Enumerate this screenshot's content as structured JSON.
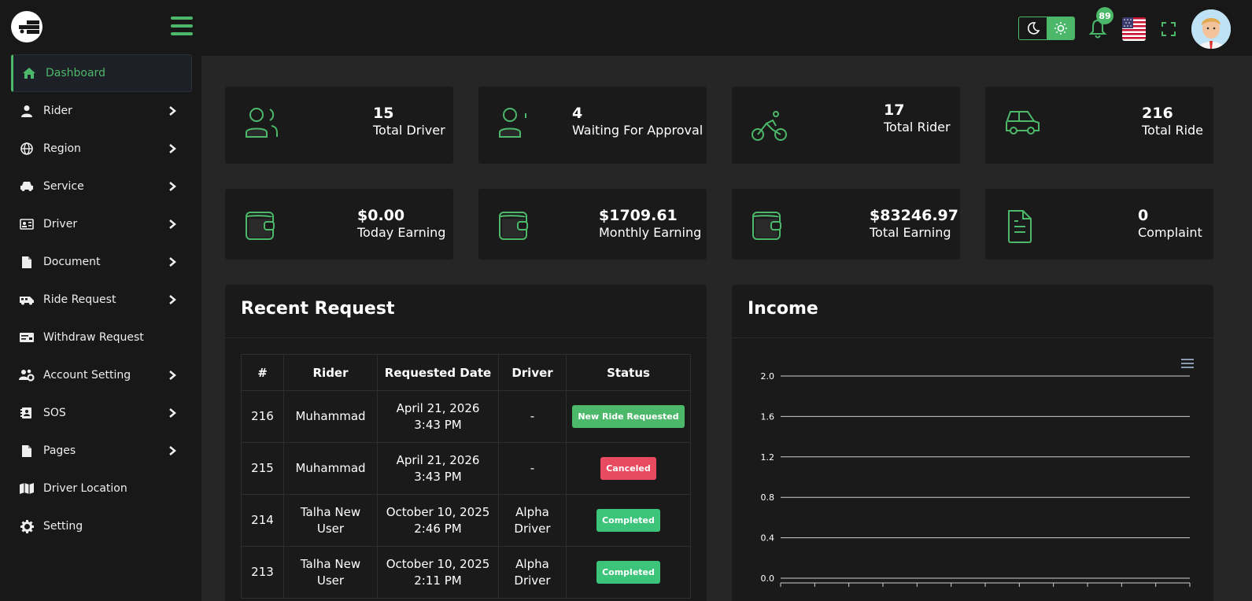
{
  "sidebar": {
    "items": [
      {
        "label": "Dashboard",
        "icon": "home-icon",
        "active": true,
        "has_submenu": false
      },
      {
        "label": "Rider",
        "icon": "user-icon",
        "active": false,
        "has_submenu": true
      },
      {
        "label": "Region",
        "icon": "globe-icon",
        "active": false,
        "has_submenu": true
      },
      {
        "label": "Service",
        "icon": "car-icon",
        "active": false,
        "has_submenu": true
      },
      {
        "label": "Driver",
        "icon": "id-card-icon",
        "active": false,
        "has_submenu": true
      },
      {
        "label": "Document",
        "icon": "file-icon",
        "active": false,
        "has_submenu": true
      },
      {
        "label": "Ride Request",
        "icon": "shuttle-icon",
        "active": false,
        "has_submenu": true
      },
      {
        "label": "Withdraw Request",
        "icon": "money-check-icon",
        "active": false,
        "has_submenu": false
      },
      {
        "label": "Account Setting",
        "icon": "users-cog-icon",
        "active": false,
        "has_submenu": true
      },
      {
        "label": "SOS",
        "icon": "address-book-icon",
        "active": false,
        "has_submenu": true
      },
      {
        "label": "Pages",
        "icon": "file-icon",
        "active": false,
        "has_submenu": true
      },
      {
        "label": "Driver Location",
        "icon": "map-icon",
        "active": false,
        "has_submenu": false
      },
      {
        "label": "Setting",
        "icon": "gear-icon",
        "active": false,
        "has_submenu": false
      }
    ]
  },
  "topbar": {
    "notification_count": "89",
    "language": "en-US",
    "theme": "dark"
  },
  "stats": [
    {
      "value": "15",
      "label": "Total Driver",
      "icon": "users-icon"
    },
    {
      "value": "4",
      "label": "Waiting For Approval",
      "icon": "user-pending-icon"
    },
    {
      "value": "17",
      "label": "Total Rider",
      "icon": "bicycle-icon"
    },
    {
      "value": "216",
      "label": "Total Ride",
      "icon": "car-icon"
    },
    {
      "value": "$0.00",
      "label": "Today Earning",
      "icon": "wallet-icon"
    },
    {
      "value": "$1709.61",
      "label": "Monthly Earning",
      "icon": "wallet-icon"
    },
    {
      "value": "$83246.97",
      "label": "Total Earning",
      "icon": "wallet-icon"
    },
    {
      "value": "0",
      "label": "Complaint",
      "icon": "document-icon"
    }
  ],
  "recent_request": {
    "title": "Recent Request",
    "columns": [
      "#",
      "Rider",
      "Requested Date",
      "Driver",
      "Status"
    ],
    "rows": [
      {
        "id": "216",
        "rider": [
          "Muhammad"
        ],
        "date": "April 21, 2026",
        "time": "3:43 PM",
        "driver": [
          "-"
        ],
        "status": "New Ride Requested",
        "status_color": "#4cb86a"
      },
      {
        "id": "215",
        "rider": [
          "Muhammad"
        ],
        "date": "April 21, 2026",
        "time": "3:43 PM",
        "driver": [
          "-"
        ],
        "status": "Canceled",
        "status_color": "#e84a5f"
      },
      {
        "id": "214",
        "rider": [
          "Talha New",
          "User"
        ],
        "date": "October 10, 2025",
        "time": "2:46 PM",
        "driver": [
          "Alpha",
          "Driver"
        ],
        "status": "Completed",
        "status_color": "#3bc47a"
      },
      {
        "id": "213",
        "rider": [
          "Talha New",
          "User"
        ],
        "date": "October 10, 2025",
        "time": "2:11 PM",
        "driver": [
          "Alpha",
          "Driver"
        ],
        "status": "Completed",
        "status_color": "#3bc47a"
      }
    ]
  },
  "income": {
    "title": "Income"
  },
  "chart_data": {
    "type": "line",
    "title": "",
    "xlabel": "",
    "ylabel": "",
    "ylim": [
      0,
      2.0
    ],
    "y_ticks": [
      "0.0",
      "0.4",
      "0.8",
      "1.2",
      "1.6",
      "2.0"
    ],
    "grid": true,
    "series": []
  },
  "colors": {
    "accent": "#4cb86a",
    "sidebar_bg": "#181818",
    "page_bg": "#262626",
    "card_bg": "#1a1a1a"
  }
}
